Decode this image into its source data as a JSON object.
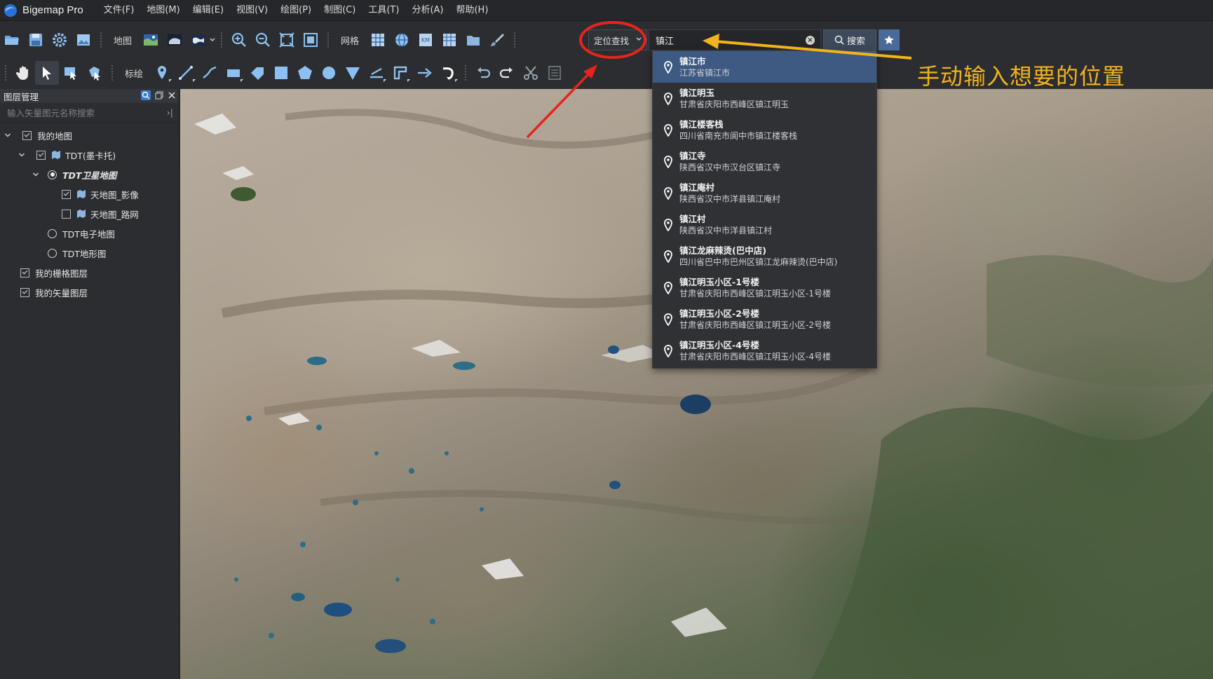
{
  "app": {
    "title": "Bigemap Pro"
  },
  "menu": [
    "文件(F)",
    "地图(M)",
    "编辑(E)",
    "视图(V)",
    "绘图(P)",
    "制图(C)",
    "工具(T)",
    "分析(A)",
    "帮助(H)"
  ],
  "toolbar1": {
    "map_label": "地图",
    "grid_label": "网格"
  },
  "toolbar2": {
    "mark_label": "标绘"
  },
  "search": {
    "mode": "定位查找",
    "value": "镇江",
    "clear_symbol": "×",
    "button_label": "搜索"
  },
  "results": [
    {
      "name": "镇江市",
      "address": "江苏省镇江市"
    },
    {
      "name": "镇江明玉",
      "address": "甘肃省庆阳市西峰区镇江明玉"
    },
    {
      "name": "镇江楼客栈",
      "address": "四川省南充市阆中市镇江楼客栈"
    },
    {
      "name": "镇江寺",
      "address": "陕西省汉中市汉台区镇江寺"
    },
    {
      "name": "镇江庵村",
      "address": "陕西省汉中市洋县镇江庵村"
    },
    {
      "name": "镇江村",
      "address": "陕西省汉中市洋县镇江村"
    },
    {
      "name": "镇江龙麻辣烫(巴中店)",
      "address": "四川省巴中市巴州区镇江龙麻辣烫(巴中店)"
    },
    {
      "name": "镇江明玉小区-1号楼",
      "address": "甘肃省庆阳市西峰区镇江明玉小区-1号楼"
    },
    {
      "name": "镇江明玉小区-2号楼",
      "address": "甘肃省庆阳市西峰区镇江明玉小区-2号楼"
    },
    {
      "name": "镇江明玉小区-4号楼",
      "address": "甘肃省庆阳市西峰区镇江明玉小区-4号楼"
    }
  ],
  "layer_panel": {
    "title": "图层管理",
    "search_placeholder": "输入矢量图元名称搜索",
    "tree": {
      "my_map": "我的地图",
      "tdt_mercator": "TDT(墨卡托)",
      "tdt_satellite": "TDT卫星地图",
      "tdt_image": "天地图_影像",
      "tdt_road": "天地图_路网",
      "tdt_electronic": "TDT电子地图",
      "tdt_terrain": "TDT地形图",
      "my_raster": "我的栅格图层",
      "my_vector": "我的矢量图层"
    }
  },
  "annotation": {
    "text": "手动输入想要的位置"
  },
  "colors": {
    "accent": "#3e5a82",
    "annotation": "#f2b31c",
    "circle": "#e8231e",
    "arrow_red": "#e8231e"
  }
}
